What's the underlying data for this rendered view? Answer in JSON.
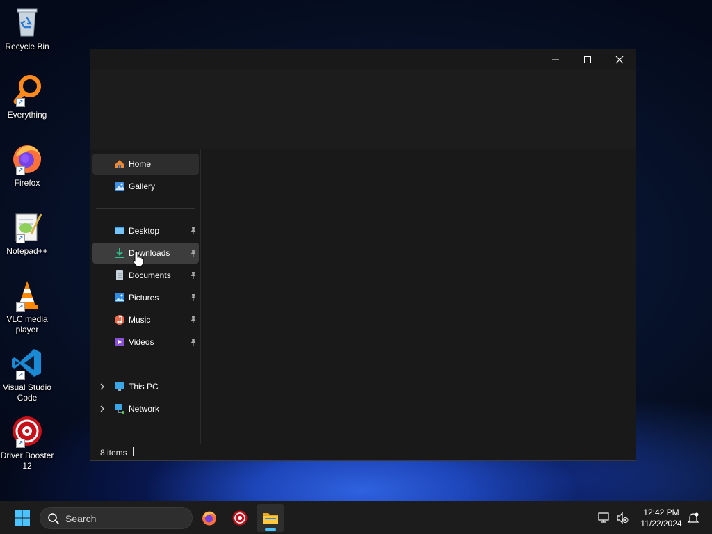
{
  "desktop": {
    "icons": [
      {
        "label": "Recycle Bin"
      },
      {
        "label": "Everything"
      },
      {
        "label": "Firefox"
      },
      {
        "label": "Notepad++"
      },
      {
        "label": "VLC media player"
      },
      {
        "label": "Visual Studio Code"
      },
      {
        "label": "Driver Booster 12"
      }
    ]
  },
  "explorer": {
    "nav": {
      "home": "Home",
      "gallery": "Gallery",
      "quick_access": [
        {
          "label": "Desktop",
          "pinned": true
        },
        {
          "label": "Downloads",
          "pinned": true
        },
        {
          "label": "Documents",
          "pinned": true
        },
        {
          "label": "Pictures",
          "pinned": true
        },
        {
          "label": "Music",
          "pinned": true
        },
        {
          "label": "Videos",
          "pinned": true
        }
      ],
      "this_pc": "This PC",
      "network": "Network"
    },
    "status": {
      "item_count": "8 items"
    }
  },
  "taskbar": {
    "search_placeholder": "Search",
    "clock": {
      "time": "12:42 PM",
      "date": "11/22/2024"
    }
  },
  "colors": {
    "accent": "#4cc2ff",
    "window_bg": "#191919",
    "taskbar_bg": "#1c1c1c"
  }
}
